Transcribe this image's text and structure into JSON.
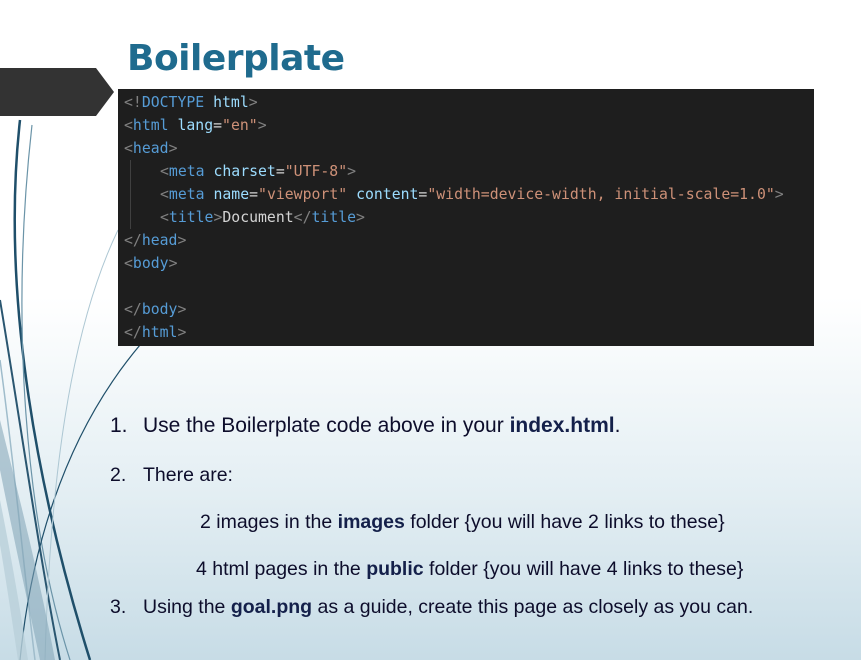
{
  "slide": {
    "title": "Boilerplate",
    "code_lines": [
      [
        {
          "c": "p",
          "t": "<!"
        },
        {
          "c": "t",
          "t": "DOCTYPE"
        },
        {
          "c": "x",
          "t": " "
        },
        {
          "c": "a",
          "t": "html"
        },
        {
          "c": "p",
          "t": ">"
        }
      ],
      [
        {
          "c": "p",
          "t": "<"
        },
        {
          "c": "t",
          "t": "html"
        },
        {
          "c": "x",
          "t": " "
        },
        {
          "c": "a",
          "t": "lang"
        },
        {
          "c": "x",
          "t": "="
        },
        {
          "c": "s",
          "t": "\"en\""
        },
        {
          "c": "p",
          "t": ">"
        }
      ],
      [
        {
          "c": "p",
          "t": "<"
        },
        {
          "c": "t",
          "t": "head"
        },
        {
          "c": "p",
          "t": ">"
        }
      ],
      [
        {
          "c": "p",
          "t": "<"
        },
        {
          "c": "t",
          "t": "meta"
        },
        {
          "c": "x",
          "t": " "
        },
        {
          "c": "a",
          "t": "charset"
        },
        {
          "c": "x",
          "t": "="
        },
        {
          "c": "s",
          "t": "\"UTF-8\""
        },
        {
          "c": "p",
          "t": ">"
        }
      ],
      [
        {
          "c": "p",
          "t": "<"
        },
        {
          "c": "t",
          "t": "meta"
        },
        {
          "c": "x",
          "t": " "
        },
        {
          "c": "a",
          "t": "name"
        },
        {
          "c": "x",
          "t": "="
        },
        {
          "c": "s",
          "t": "\"viewport\""
        },
        {
          "c": "x",
          "t": " "
        },
        {
          "c": "a",
          "t": "content"
        },
        {
          "c": "x",
          "t": "="
        },
        {
          "c": "s",
          "t": "\"width=device-width, initial-scale=1.0\""
        },
        {
          "c": "p",
          "t": ">"
        }
      ],
      [
        {
          "c": "p",
          "t": "<"
        },
        {
          "c": "t",
          "t": "title"
        },
        {
          "c": "p",
          "t": ">"
        },
        {
          "c": "x",
          "t": "Document"
        },
        {
          "c": "p",
          "t": "</"
        },
        {
          "c": "t",
          "t": "title"
        },
        {
          "c": "p",
          "t": ">"
        }
      ],
      [
        {
          "c": "p",
          "t": "</"
        },
        {
          "c": "t",
          "t": "head"
        },
        {
          "c": "p",
          "t": ">"
        }
      ],
      [
        {
          "c": "p",
          "t": "<"
        },
        {
          "c": "t",
          "t": "body"
        },
        {
          "c": "p",
          "t": ">"
        }
      ],
      [],
      [
        {
          "c": "p",
          "t": "</"
        },
        {
          "c": "t",
          "t": "body"
        },
        {
          "c": "p",
          "t": ">"
        }
      ],
      [
        {
          "c": "p",
          "t": "</"
        },
        {
          "c": "t",
          "t": "html"
        },
        {
          "c": "p",
          "t": ">"
        }
      ]
    ],
    "instructions": [
      {
        "number": "1.",
        "parts": [
          {
            "text": "Use the Boilerplate code above  in your "
          },
          {
            "text": "index.html",
            "bold": true
          },
          {
            "text": "."
          }
        ]
      },
      {
        "number": "2.",
        "parts": [
          {
            "text": "There are:"
          }
        ]
      },
      {
        "number": "",
        "parts": [
          {
            "text": "2 images in the "
          },
          {
            "text": "images",
            "bold": true
          },
          {
            "text": " folder {you will have 2 links to these}"
          }
        ]
      },
      {
        "number": "",
        "parts": [
          {
            "text": "4 html pages in the "
          },
          {
            "text": "public",
            "bold": true
          },
          {
            "text": " folder {you will have 4 links to these}"
          }
        ]
      },
      {
        "number": "3.",
        "parts": [
          {
            "text": "Using the "
          },
          {
            "text": "goal.png",
            "bold": true
          },
          {
            "text": " as a guide, create this page as closely as you can."
          }
        ]
      }
    ]
  },
  "colors": {
    "title": "#1f6b8e",
    "code_bg": "#1e1e1e",
    "tag": "#569cd6",
    "attr": "#9cdcfe",
    "string": "#ce9178",
    "punct": "#808080",
    "text": "#0d0d2b"
  }
}
